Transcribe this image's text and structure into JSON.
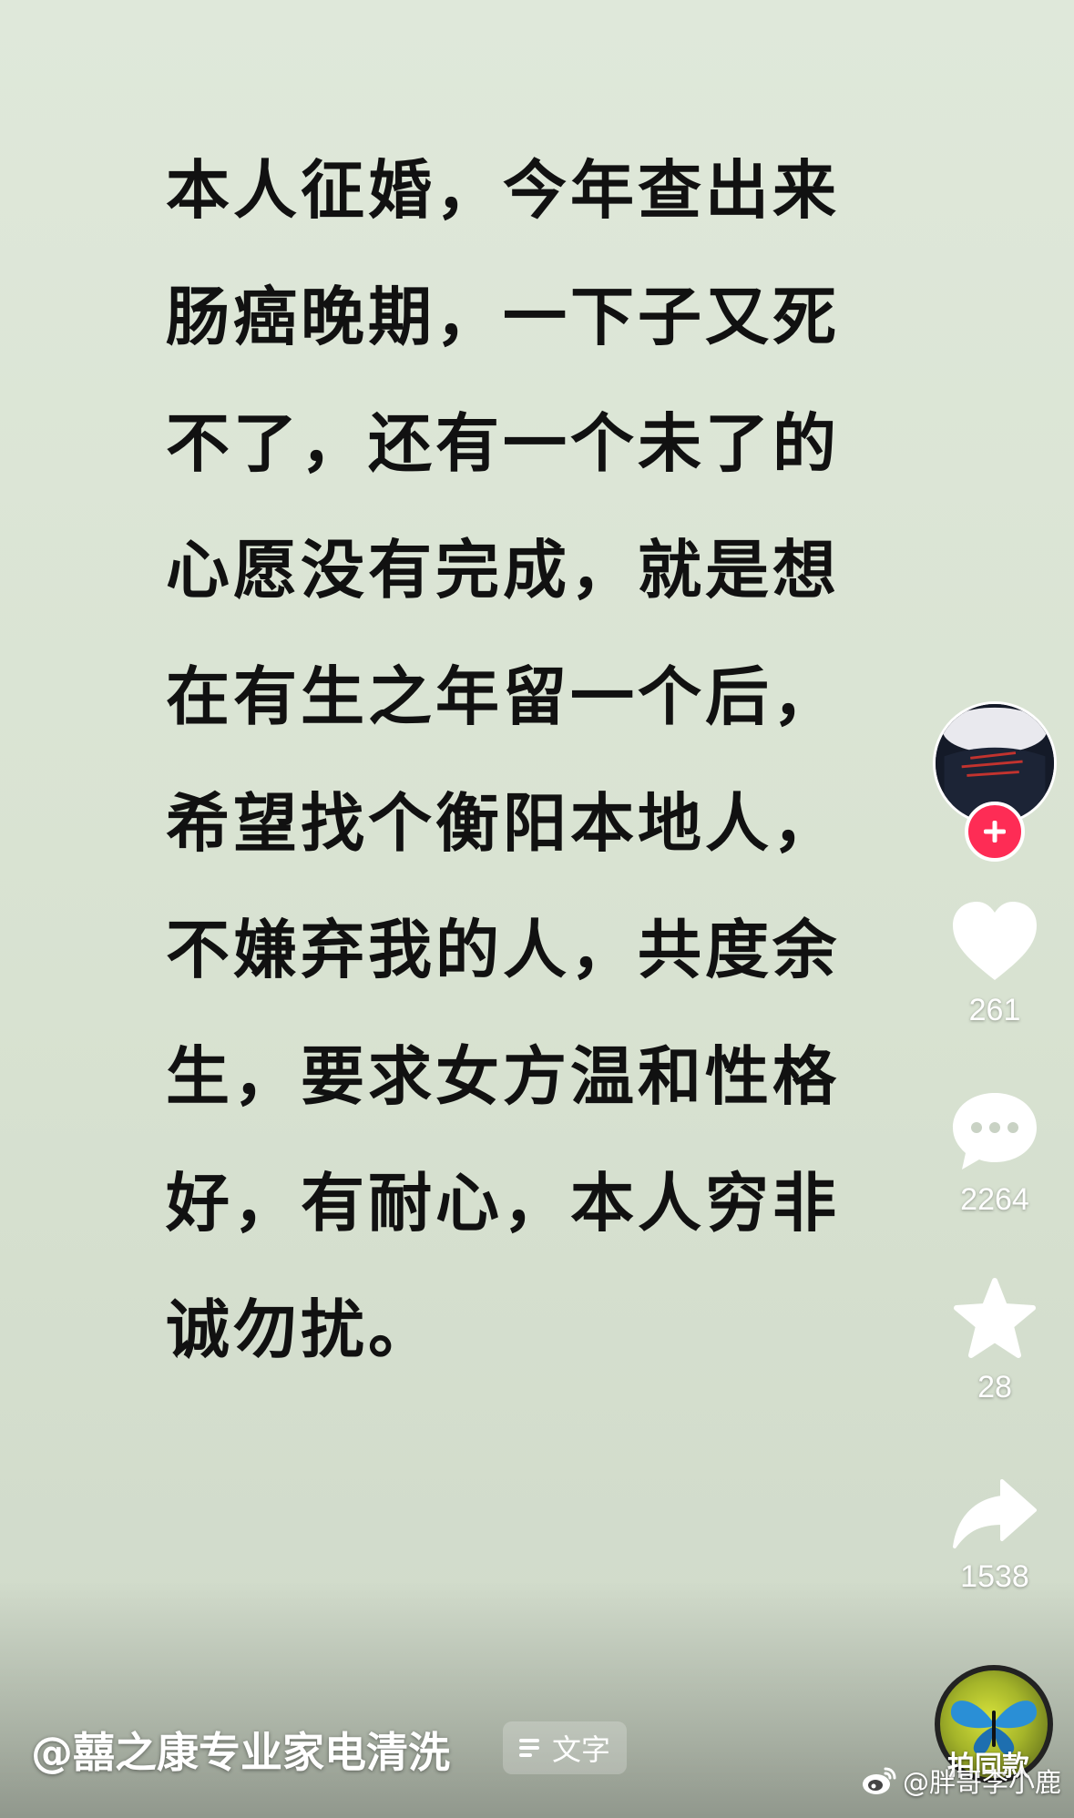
{
  "post": {
    "lines": [
      " 本人征婚，今年查出来",
      "肠癌晚期，一下子又死",
      "不了，还有一个未了的",
      "心愿没有完成，就是想",
      "在有生之年留一个后，",
      "希望找个衡阳本地人，",
      "不嫌弃我的人，共度余",
      "生，要求女方温和性格",
      "好，有耐心，本人穷非",
      "诚勿扰。"
    ]
  },
  "rail": {
    "like_count": "261",
    "comment_count": "2264",
    "favorite_count": "28",
    "share_count": "1538",
    "remix_label": "拍同款"
  },
  "footer": {
    "author": "@囍之康专业家电清洗",
    "tag_label": "文字"
  },
  "watermark": {
    "text": "@胖哥李小鹿"
  },
  "icons": {
    "follow": "plus-icon",
    "like": "heart-icon",
    "comment": "comment-bubble-icon",
    "favorite": "star-icon",
    "share": "share-arrow-icon",
    "text_tag": "text-lines-icon",
    "watermark": "weibo-icon"
  },
  "colors": {
    "background": "#d9e4d3",
    "text": "#111111",
    "follow_badge": "#fe2c55",
    "icon": "#ffffff"
  }
}
